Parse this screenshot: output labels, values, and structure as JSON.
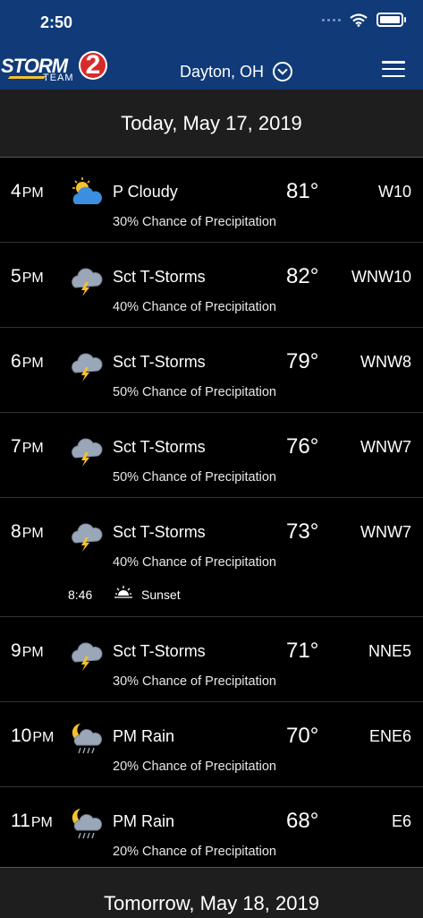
{
  "status": {
    "time": "2:50"
  },
  "header": {
    "logo_text": "STORM",
    "logo_number": "2",
    "logo_sub": "TEAM",
    "location": "Dayton, OH"
  },
  "date_header": "Today, May 17, 2019",
  "hours": [
    {
      "hour": "4",
      "ampm": "PM",
      "icon": "partly-cloudy-icon",
      "condition": "P Cloudy",
      "temp": "81°",
      "wind": "W10",
      "precip": "30% Chance of Precipitation"
    },
    {
      "hour": "5",
      "ampm": "PM",
      "icon": "thunderstorm-icon",
      "condition": "Sct T-Storms",
      "temp": "82°",
      "wind": "WNW10",
      "precip": "40% Chance of Precipitation"
    },
    {
      "hour": "6",
      "ampm": "PM",
      "icon": "thunderstorm-icon",
      "condition": "Sct T-Storms",
      "temp": "79°",
      "wind": "WNW8",
      "precip": "50% Chance of Precipitation"
    },
    {
      "hour": "7",
      "ampm": "PM",
      "icon": "thunderstorm-icon",
      "condition": "Sct T-Storms",
      "temp": "76°",
      "wind": "WNW7",
      "precip": "50% Chance of Precipitation"
    },
    {
      "hour": "8",
      "ampm": "PM",
      "icon": "thunderstorm-icon",
      "condition": "Sct T-Storms",
      "temp": "73°",
      "wind": "WNW7",
      "precip": "40% Chance of Precipitation",
      "sunset_time": "8:46",
      "sunset_label": "Sunset"
    },
    {
      "hour": "9",
      "ampm": "PM",
      "icon": "thunderstorm-icon",
      "condition": "Sct T-Storms",
      "temp": "71°",
      "wind": "NNE5",
      "precip": "30% Chance of Precipitation"
    },
    {
      "hour": "10",
      "ampm": "PM",
      "icon": "night-rain-icon",
      "condition": "PM Rain",
      "temp": "70°",
      "wind": "ENE6",
      "precip": "20% Chance of Precipitation"
    },
    {
      "hour": "11",
      "ampm": "PM",
      "icon": "night-rain-icon",
      "condition": "PM Rain",
      "temp": "68°",
      "wind": "E6",
      "precip": "20% Chance of Precipitation"
    }
  ],
  "next_date_header": "Tomorrow, May 18, 2019"
}
